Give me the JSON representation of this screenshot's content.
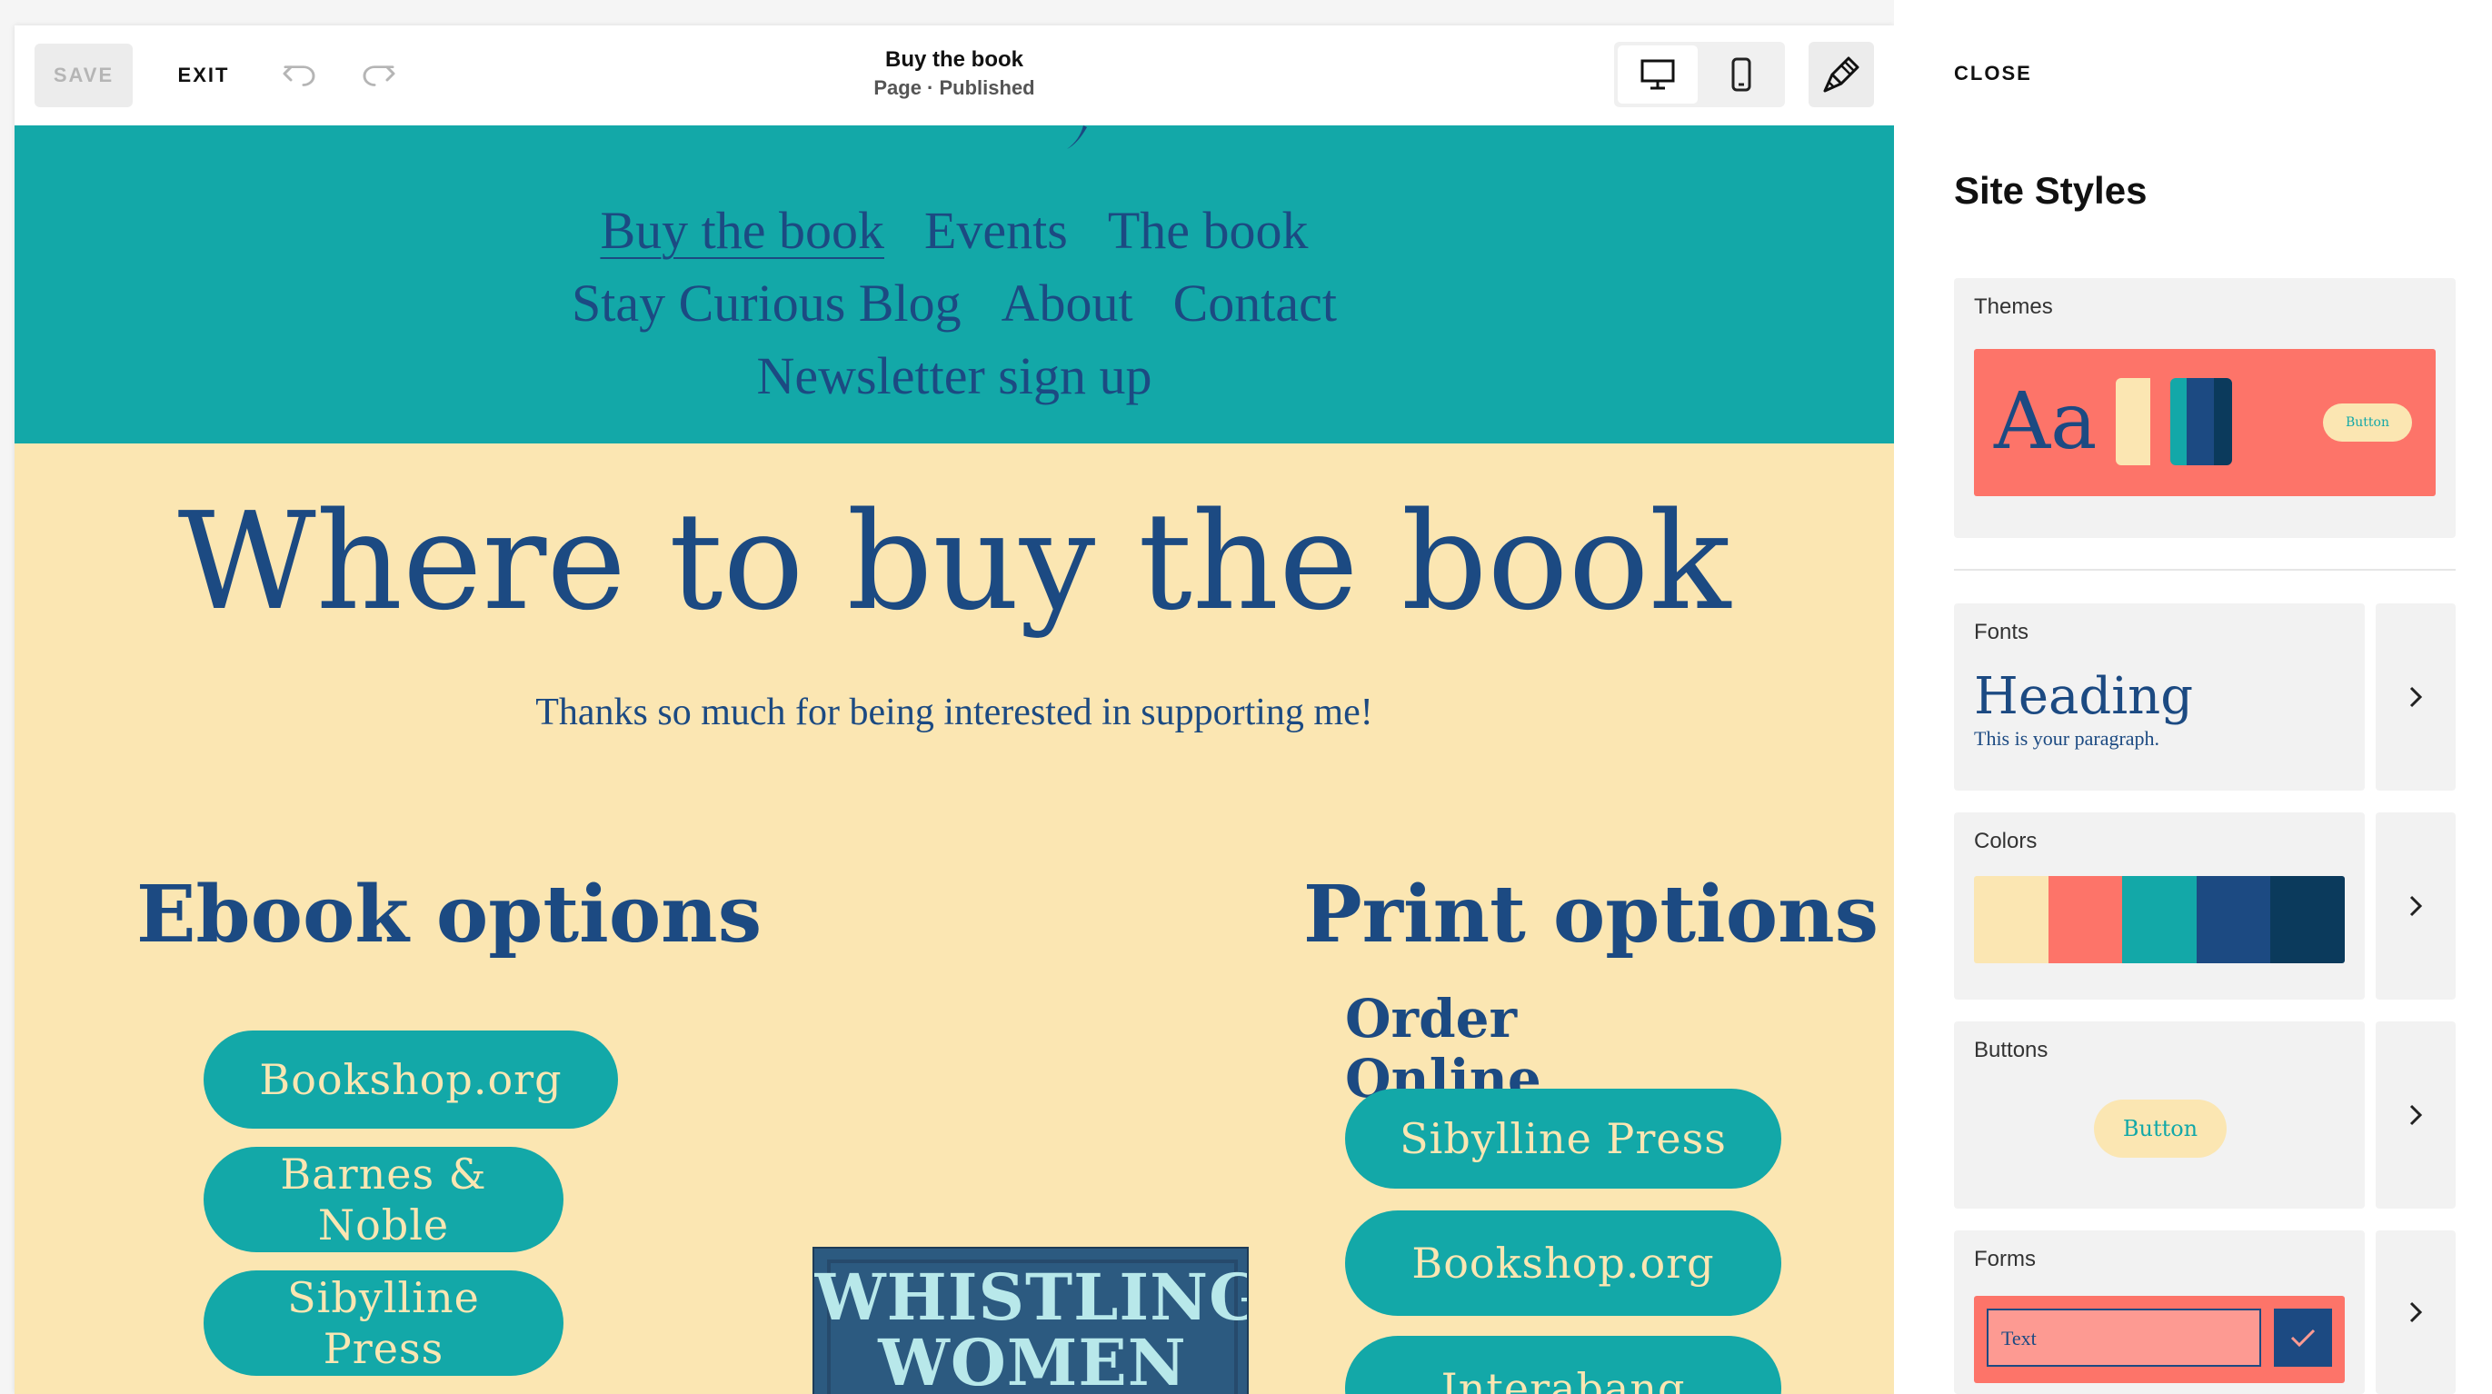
{
  "toolbar": {
    "save_label": "SAVE",
    "exit_label": "EXIT",
    "page_title": "Buy the book",
    "page_status": "Page · Published"
  },
  "site": {
    "nav": {
      "row1": [
        "Buy the book",
        "Events",
        "The book"
      ],
      "row2": [
        "Stay Curious Blog",
        "About",
        "Contact"
      ],
      "row3": [
        "Newsletter sign up"
      ],
      "active": "Buy the book"
    },
    "hero_title": "Where to buy the book",
    "hero_subtitle": "Thanks so much for being interested in supporting me!",
    "ebook": {
      "heading": "Ebook options",
      "buttons": [
        "Bookshop.org",
        "Barnes &\nNoble",
        "Sibylline\nPress"
      ]
    },
    "print": {
      "heading": "Print options",
      "subheading": "Order\nOnline",
      "buttons": [
        "Sibylline Press",
        "Bookshop.org",
        "Interabang"
      ]
    },
    "book_cover_text": "WHISTLING\nWOMEN"
  },
  "panel": {
    "close_label": "CLOSE",
    "title": "Site Styles",
    "themes": {
      "label": "Themes",
      "sample": "Aa",
      "button_label": "Button"
    },
    "fonts": {
      "label": "Fonts",
      "heading_sample": "Heading",
      "paragraph_sample": "This is your paragraph."
    },
    "colors": {
      "label": "Colors",
      "palette": [
        "#fbe6b2",
        "#fd7469",
        "#13a8a8",
        "#1c4a82",
        "#0b3a5c"
      ]
    },
    "buttons": {
      "label": "Buttons",
      "sample": "Button"
    },
    "forms": {
      "label": "Forms",
      "input_sample": "Text"
    }
  },
  "icons": [
    "undo-icon",
    "redo-icon",
    "desktop-icon",
    "mobile-icon",
    "paintbrush-icon",
    "chevron-right-icon",
    "checkmark-icon"
  ]
}
